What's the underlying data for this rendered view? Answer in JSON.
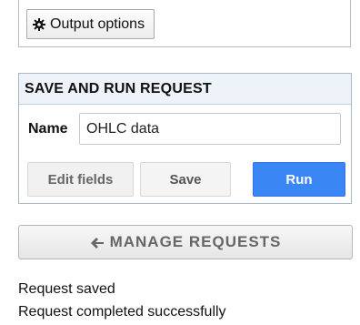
{
  "output_panel": {
    "button_label": "Output options",
    "icon": "gear-icon"
  },
  "save_run": {
    "title": "SAVE AND RUN REQUEST",
    "name_label": "Name",
    "name_value": "OHLC data",
    "edit_label": "Edit fields",
    "save_label": "Save",
    "run_label": "Run",
    "run_color": "#3b86f5"
  },
  "manage": {
    "label": "MANAGE REQUESTS",
    "icon": "arrow-left-icon"
  },
  "status": {
    "messages": [
      "Request saved",
      "Request completed successfully"
    ]
  }
}
